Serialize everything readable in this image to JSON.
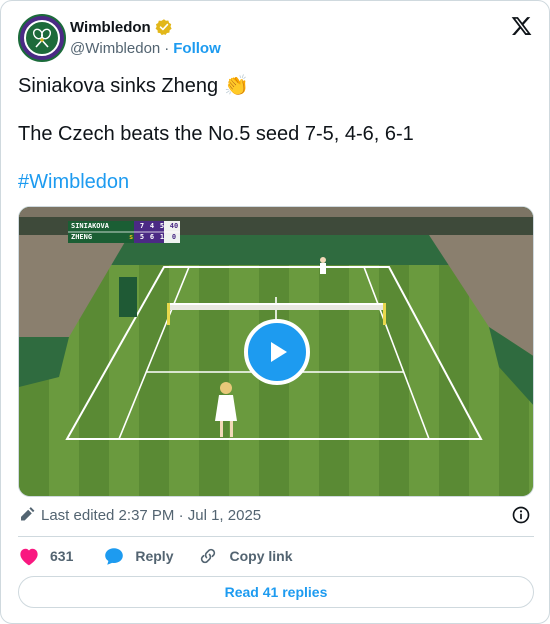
{
  "author": {
    "name": "Wimbledon",
    "handle": "@Wimbledon",
    "separator": "·",
    "follow_label": "Follow",
    "avatar_text": "THE CHAMPIONSHIPS WIMBLEDON"
  },
  "tweet": {
    "line1": "Siniakova sinks Zheng",
    "emoji": "👏",
    "line2": "The Czech beats the No.5 seed 7-5, 4-6, 6-1",
    "hashtag": "#Wimbledon"
  },
  "scoreboard": {
    "rows": [
      {
        "player": "SINIAKOVA",
        "marker": "",
        "sets": [
          "7",
          "4",
          "5"
        ],
        "points": "40"
      },
      {
        "player": "ZHENG",
        "marker": "s",
        "sets": [
          "5",
          "6",
          "1"
        ],
        "points": "0"
      }
    ]
  },
  "meta": {
    "edited_text": "Last edited 2:37 PM · Jul 1, 2025"
  },
  "actions": {
    "likes": "631",
    "reply_label": "Reply",
    "copy_label": "Copy link"
  },
  "read_replies_label": "Read 41 replies",
  "colors": {
    "accent": "#1d9bf0",
    "like": "#f91880",
    "text": "#0f1419",
    "secondary": "#536471",
    "border": "#cfd9de",
    "verified_gold": "#e2b719"
  }
}
